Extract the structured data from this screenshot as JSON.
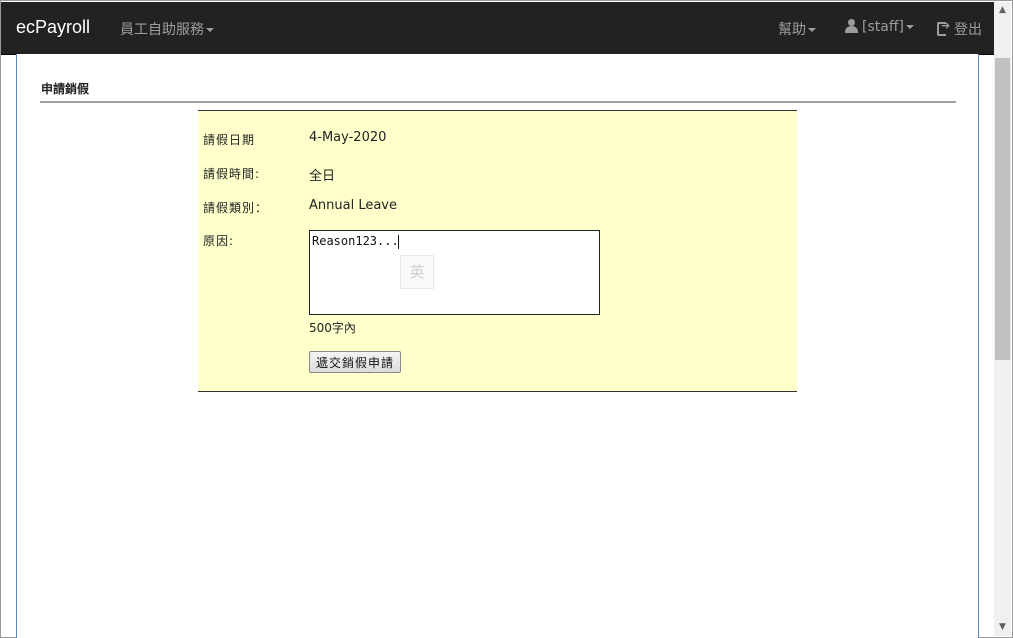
{
  "navbar": {
    "brand": "ecPayroll",
    "self_service": "員工自助服務",
    "help": "幫助",
    "user": "[staff]",
    "logout": "登出"
  },
  "page": {
    "section_title": "申請銷假"
  },
  "form": {
    "date_label": "請假日期",
    "date_value": "4-May-2020",
    "time_label": "請假時間:",
    "time_value": "全日",
    "type_label": "請假類別：",
    "type_value": "Annual Leave",
    "reason_label": "原因:",
    "reason_value": "Reason123...",
    "ime_indicator": "英",
    "char_limit": "500字內",
    "submit_label": "遞交銷假申請"
  },
  "colors": {
    "navbar_bg": "#222222",
    "form_bg": "#ffffcc",
    "frame_border": "#5b87b8"
  }
}
